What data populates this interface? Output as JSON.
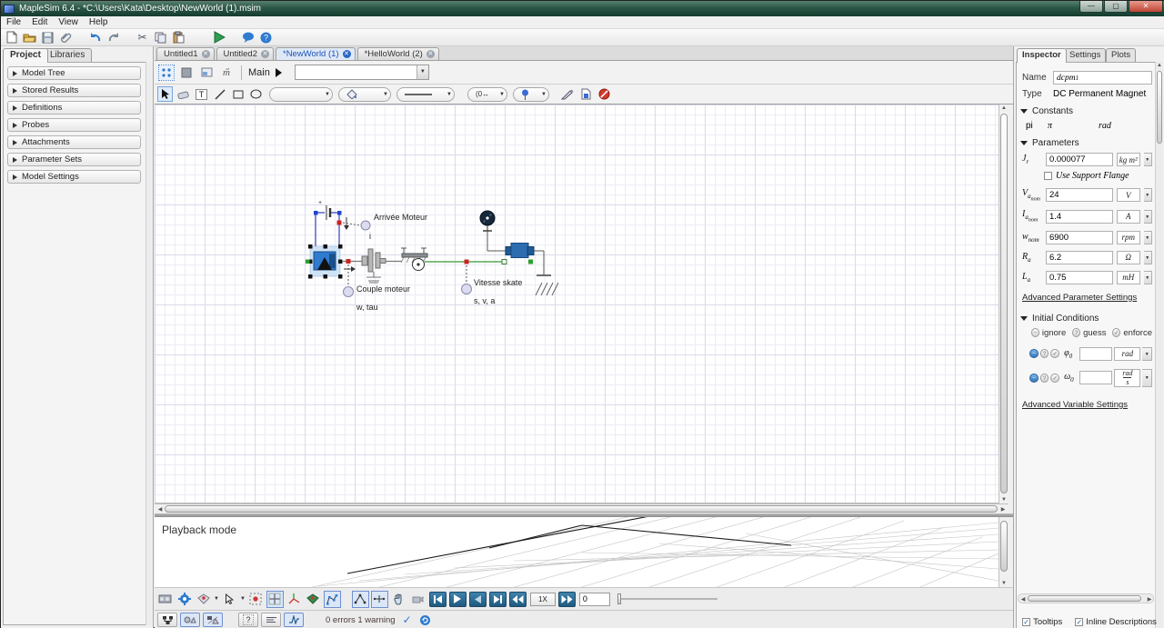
{
  "window": {
    "title": "MapleSim 6.4  -   *C:\\Users\\Kata\\Desktop\\NewWorld (1).msim"
  },
  "menu": {
    "items": [
      "File",
      "Edit",
      "View",
      "Help"
    ]
  },
  "left_panel": {
    "tabs": [
      {
        "label": "Project"
      },
      {
        "label": "Libraries"
      }
    ],
    "sections": [
      "Model Tree",
      "Stored Results",
      "Definitions",
      "Probes",
      "Attachments",
      "Parameter Sets",
      "Model Settings"
    ]
  },
  "doc_tabs": [
    {
      "label": "Untitled1"
    },
    {
      "label": "Untitled2"
    },
    {
      "label": "*NewWorld (1)",
      "active": true
    },
    {
      "label": "*HelloWorld (2)"
    }
  ],
  "nav": {
    "breadcrumb": "Main"
  },
  "canvas_labels": {
    "probe1_title": "Arrivée Moteur",
    "probe1_sub": "i",
    "probe2_title": "Couple moteur",
    "probe2_sub": "w, tau",
    "probe3_title": "Vitesse skate",
    "probe3_sub": "s, v, a"
  },
  "playback": {
    "mode_label": "Playback mode",
    "speed": "1X",
    "time": "0"
  },
  "statusbar": {
    "message": "0 errors 1 warning"
  },
  "inspector": {
    "tabs": [
      {
        "label": "Inspector"
      },
      {
        "label": "Settings"
      },
      {
        "label": "Plots"
      }
    ],
    "name_label": "Name",
    "name_value": "dcpm",
    "name_sub": "1",
    "type_label": "Type",
    "type_value": "DC Permanent Magnet",
    "constants": {
      "title": "Constants",
      "row": {
        "name": "pi",
        "value": "π",
        "unit": "rad"
      }
    },
    "parameters": {
      "title": "Parameters",
      "support_flange_label": "Use Support Flange",
      "rows": [
        {
          "sym": "J",
          "sub": "r",
          "sub2": "",
          "value": "0.000077",
          "unit": "kg m²"
        },
        {
          "sym": "V",
          "sub": "a",
          "sub2": "nom",
          "value": "24",
          "unit": "V"
        },
        {
          "sym": "I",
          "sub": "a",
          "sub2": "nom",
          "value": "1.4",
          "unit": "A"
        },
        {
          "sym": "w",
          "sub": "nom",
          "sub2": "",
          "value": "6900",
          "unit": "rpm"
        },
        {
          "sym": "R",
          "sub": "a",
          "sub2": "",
          "value": "6.2",
          "unit": "Ω"
        },
        {
          "sym": "L",
          "sub": "a",
          "sub2": "",
          "value": "0.75",
          "unit": "mH"
        }
      ],
      "advanced_link": "Advanced Parameter Settings"
    },
    "initial_conditions": {
      "title": "Initial Conditions",
      "legend": [
        "ignore",
        "guess",
        "enforce"
      ],
      "rows": [
        {
          "sym": "φ",
          "sub": "0",
          "value": "",
          "unit": "rad"
        },
        {
          "sym": "ω",
          "sub": "0",
          "value": "",
          "unit_num": "rad",
          "unit_den": "s"
        }
      ],
      "advanced_link": "Advanced Variable Settings"
    },
    "footer_checkboxes": [
      {
        "label": "Tooltips"
      },
      {
        "label": "Inline Descriptions"
      }
    ]
  }
}
